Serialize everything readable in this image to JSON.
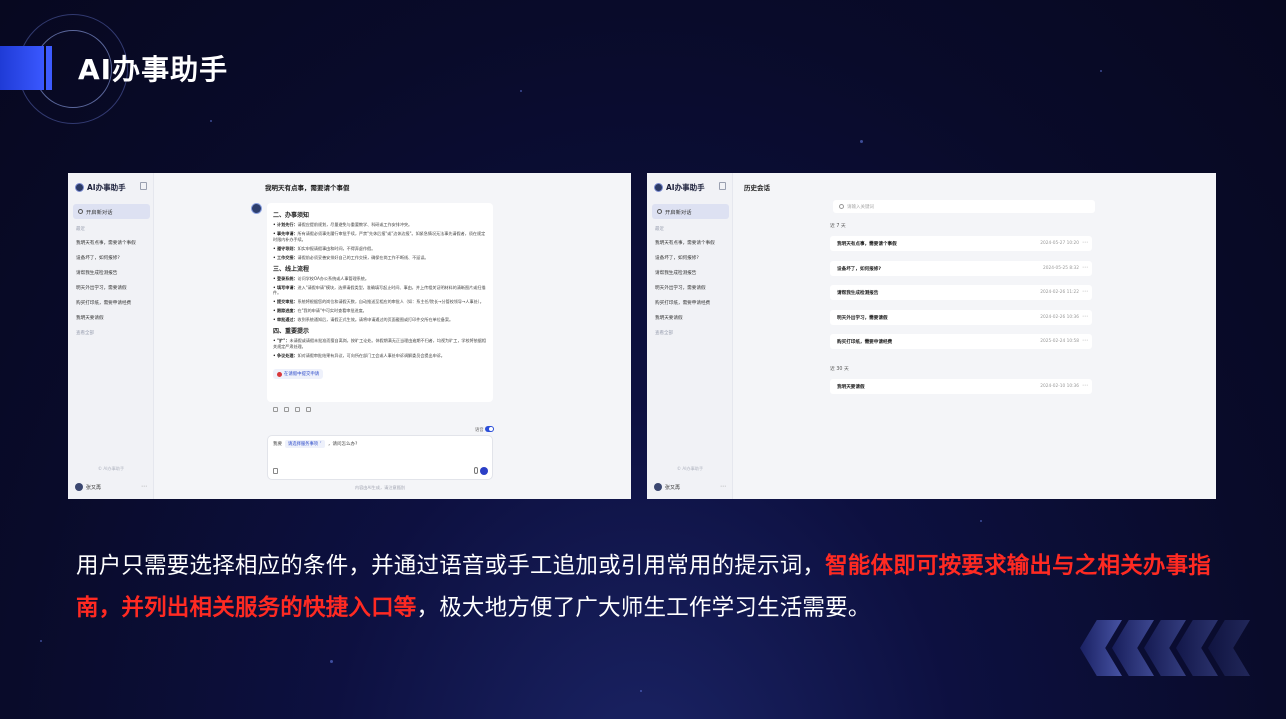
{
  "page": {
    "title": "AI办事助手",
    "caption": {
      "normal_1": "用户只需要选择相应的条件，并通过语音或手工追加或引用常用的提示词，",
      "highlight": "智能体即可按要求输出与之相关办事指南，并列出相关服务的快捷入口等",
      "normal_2": "，极大地方便了广大师生工作学习生活需要。"
    },
    "colors": {
      "highlight": "#ff2a22",
      "accent": "#2b4ed8",
      "background": "#090b2a"
    }
  },
  "shot1": {
    "sidebar": {
      "logo": "AI办事助手",
      "new_chat": "开启新对话",
      "section": "最近",
      "items": [
        "我明天有点事，需要请个事假",
        "设备坏了，如何报修?",
        "请帮我生成检测报告",
        "明天外出学习，需要请假",
        "购买打印纸，需要申请经费",
        "我明天要请假"
      ],
      "view_all": "查看全部",
      "footer": "© AI办事助手",
      "user": "张又再"
    },
    "chat_title": "我明天有点事，需要请个事假",
    "answer": {
      "h1": "二、办事须知",
      "p1a_label": "• 计划先行：",
      "p1a": "请假应提前规划，尽量避免与重要教学、科研或工作安排冲突。",
      "p1b_label": "• 事先申请：",
      "p1b": "所有请假必须事先履行审批手续，严禁\"先休后报\"或\"边休边报\"。如紧急情况无法事先请假者，须在规定时限内补办手续。",
      "p1c_label": "• 遵守导则：",
      "p1c": "如实申报请假事由和时间，不得弄虚作假。",
      "p1d_label": "• 工作交接：",
      "p1d": "请假前必须妥善安排好自己的工作交接，确保在岗工作不断线、不延误。",
      "h2": "三、线上流程",
      "p2a_label": "• 登录系统：",
      "p2a": "访问学校OA办公系统或人事管理系统。",
      "p2b_label": "• 填写申请：",
      "p2b": "进入\"请假申请\"模块，选择请假类型，准确填写起止时间、事由，并上传相关证明材料的清晰图片或扫描件。",
      "p2c_label": "• 提交审批：",
      "p2c": "系统将根据您的岗位和请假天数，自动推送至相应的审批人（如：系主任/院长→分管校领导→人事处）。",
      "p2d_label": "• 跟踪进度：",
      "p2d": "在\"我的申请\"中可实时查看审批进度。",
      "p2e_label": "• 审批通过：",
      "p2e": "收到系统通知后，请假正式生效。请将申请通过的页面截图或打印件交所在单位备案。",
      "h3": "四、重要提示",
      "p3a_label": "• \"扩\"：",
      "p3a": "未请假或请假未批准而擅自离岗，按旷工论处。休假期满无正当理由逾期不归者，均视为旷工，学校将依据相关规定严肃处理。",
      "p3b_label": "• 争议处理：",
      "p3b": "如对请假审批结果有异议，可向所在部门工会或人事处申诉调解委员会提出申诉。",
      "service_button": "在请假中提交申请"
    },
    "toggle_label": "语音",
    "input": {
      "prefix": "我要",
      "chip": "请选择服务事项 ˅",
      "question": "，请问怎么办?"
    },
    "disclaimer": "内容由AI生成，请注意甄别"
  },
  "shot2": {
    "sidebar": {
      "logo": "AI办事助手",
      "new_chat": "开启新对话",
      "section": "最近",
      "items": [
        "我明天有点事，需要请个事假",
        "设备坏了，如何报修?",
        "请帮我生成检测报告",
        "明天外出学习，需要请假",
        "购买打印纸，需要申请经费",
        "我明天要请假"
      ],
      "view_all": "查看全部",
      "footer": "© AI办事助手",
      "user": "张又再"
    },
    "title": "历史会话",
    "search_placeholder": "请输入关键词",
    "groups": [
      {
        "label": "近 7 天",
        "rows": [
          {
            "title": "我明天有点事，需要请个事假",
            "date": "2024-05-27 10:20"
          },
          {
            "title": "设备坏了，如何报修?",
            "date": "2024-05-25 8:32"
          },
          {
            "title": "请帮我生成检测报告",
            "date": "2024-02-26 11:22"
          },
          {
            "title": "明天外出学习，需要请假",
            "date": "2024-02-26 10:36"
          },
          {
            "title": "购买打印纸，需要申请经费",
            "date": "2025-02-24 10:58"
          }
        ]
      },
      {
        "label": "近 30 天",
        "rows": [
          {
            "title": "我明天要请假",
            "date": "2024-02-10 10:36"
          }
        ]
      }
    ]
  }
}
